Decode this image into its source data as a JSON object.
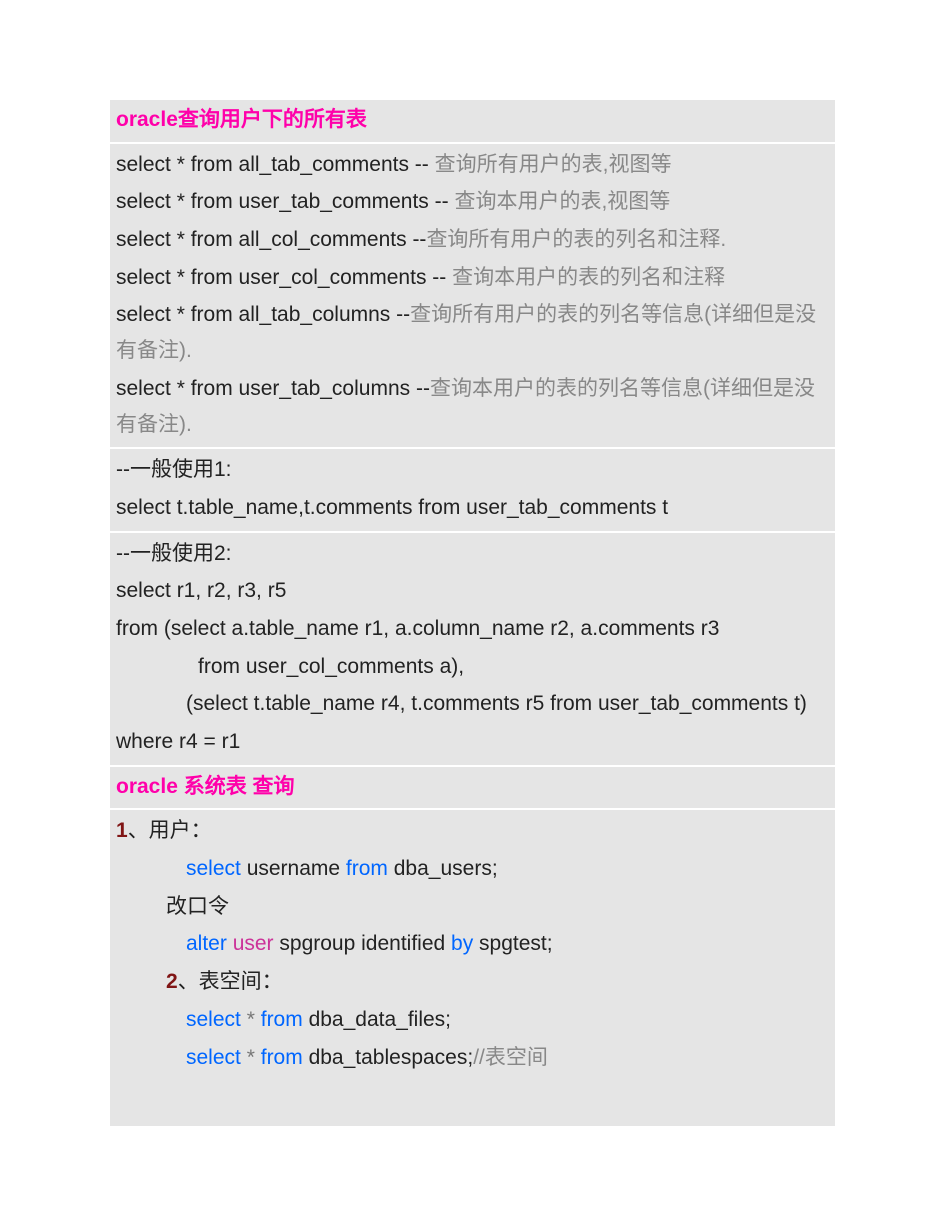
{
  "section1_title": "oracle查询用户下的所有表",
  "s1": {
    "l1a": "select * from all_tab_comments -- ",
    "l1b": "查询所有用户的表,视图等",
    "l2a": "select * from user_tab_comments    -- ",
    "l2b": "查询本用户的表,视图等",
    "l3a": "select * from all_col_comments --",
    "l3b": "查询所有用户的表的列名和注释.",
    "l4a": "select * from user_col_comments -- ",
    "l4b": "查询本用户的表的列名和注释",
    "l5a": "select * from all_tab_columns --",
    "l5b": "查询所有用户的表的列名等信息(详细但是没有备注).",
    "l6a": "select * from user_tab_columns --",
    "l6b": "查询本用户的表的列名等信息(详细但是没有备注)."
  },
  "s2": {
    "l1": "--一般使用1:",
    "l2": "select t.table_name,t.comments from user_tab_comments t"
  },
  "s3": {
    "l1": "--一般使用2:",
    "l2": "select r1, r2, r3, r5",
    "l3": "from (select a.table_name r1, a.column_name r2, a.comments r3",
    "l4": "from user_col_comments a),",
    "l5": "(select t.table_name r4, t.comments r5 from user_tab_comments t)",
    "l6": "where r4 = r1"
  },
  "section2_title": "oracle 系统表 查询",
  "s4": {
    "n1": "1",
    "t1": "、用户：",
    "kw_select": "select",
    "kw_from": "from",
    "kw_alter": "alter",
    "kw_user": "user",
    "kw_by": "by",
    "star": "*",
    "l1b": " username ",
    "l1c": " dba_users;",
    "l2": "改口令",
    "l3b": " spgroup identified ",
    "l3c": " spgtest;",
    "n2": "2",
    "t2": "、表空间：",
    "l4c": " dba_data_files;",
    "l5c": " dba_tablespaces;",
    "l5d": "//表空间"
  }
}
